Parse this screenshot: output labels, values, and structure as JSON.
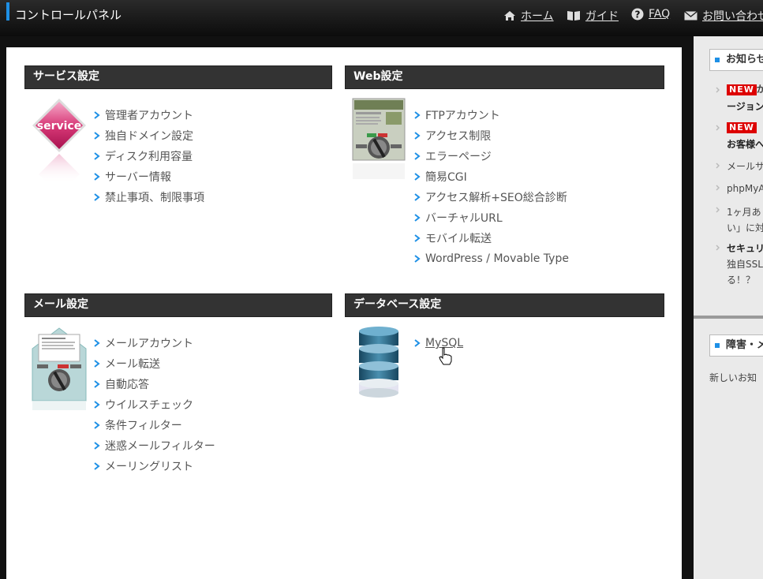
{
  "header": {
    "title": "コントロールパネル",
    "nav": [
      {
        "label": "ホーム",
        "icon": "home-icon"
      },
      {
        "label": "ガイド",
        "icon": "book-icon"
      },
      {
        "label": "FAQ",
        "icon": "help-icon"
      },
      {
        "label": "お問い合わせ",
        "icon": "mail-icon"
      }
    ]
  },
  "sections": {
    "service": {
      "title": "サービス設定",
      "icon_text": "service",
      "items": [
        "管理者アカウント",
        "独自ドメイン設定",
        "ディスク利用容量",
        "サーバー情報",
        "禁止事項、制限事項"
      ]
    },
    "web": {
      "title": "Web設定",
      "items": [
        "FTPアカウント",
        "アクセス制限",
        "エラーページ",
        "簡易CGI",
        "アクセス解析+SEO総合診断",
        "バーチャルURL",
        "モバイル転送",
        "WordPress / Movable Type"
      ]
    },
    "mail": {
      "title": "メール設定",
      "items": [
        "メールアカウント",
        "メール転送",
        "自動応答",
        "ウイルスチェック",
        "条件フィルター",
        "迷惑メールフィルター",
        "メーリングリスト"
      ]
    },
    "database": {
      "title": "データベース設定",
      "items": [
        "MySQL"
      ]
    }
  },
  "sidebar": {
    "news_title": "お知らせ",
    "new_badge": "NEW",
    "news": [
      {
        "line1": "が",
        "line2": "ージョン"
      },
      {
        "line1": "【",
        "line2": "お客様へ"
      },
      {
        "line1": "メールサ"
      },
      {
        "line1": "phpMyA"
      },
      {
        "line1": "1ヶ月あ",
        "line2": "い」に対"
      },
      {
        "line1": "セキュリ",
        "line2": "独自SSL",
        "line3": "る！？"
      }
    ],
    "trouble_title": "障害・メ",
    "trouble_text": "新しいお知"
  },
  "colors": {
    "accent": "#1e90e6",
    "section_header": "#333333",
    "new_badge": "#dd0000"
  }
}
